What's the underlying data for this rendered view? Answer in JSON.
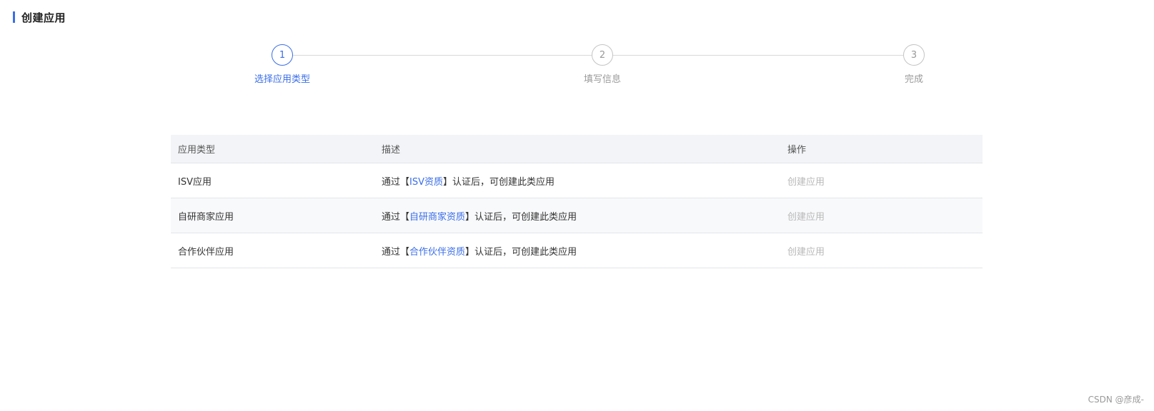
{
  "page": {
    "title": "创建应用",
    "accent_color": "#3a6ee8"
  },
  "steps": [
    {
      "number": "1",
      "label": "选择应用类型",
      "state": "active"
    },
    {
      "number": "2",
      "label": "填写信息",
      "state": "pending"
    },
    {
      "number": "3",
      "label": "完成",
      "state": "pending"
    }
  ],
  "table": {
    "headers": {
      "type": "应用类型",
      "description": "描述",
      "operation": "操作"
    },
    "rows": [
      {
        "type": "ISV应用",
        "desc_prefix": "通过",
        "bracket_open": "【",
        "desc_link": "ISV资质",
        "bracket_close": "】",
        "desc_suffix": "认证后，可创建此类应用",
        "action": "创建应用"
      },
      {
        "type": "自研商家应用",
        "desc_prefix": "通过",
        "bracket_open": "【",
        "desc_link": "自研商家资质",
        "bracket_close": "】",
        "desc_suffix": "认证后，可创建此类应用",
        "action": "创建应用"
      },
      {
        "type": "合作伙伴应用",
        "desc_prefix": "通过",
        "bracket_open": "【",
        "desc_link": "合作伙伴资质",
        "bracket_close": "】",
        "desc_suffix": "认证后，可创建此类应用",
        "action": "创建应用"
      }
    ]
  },
  "watermark": "CSDN @彦成-"
}
